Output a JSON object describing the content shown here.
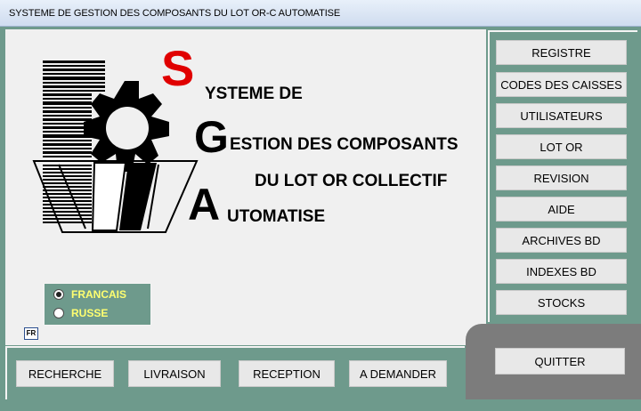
{
  "window": {
    "title": "SYSTEME DE GESTION DES COMPOSANTS DU LOT OR-C AUTOMATISE"
  },
  "logo": {
    "letter_s": "S",
    "line1": "YSTEME DE",
    "letter_g": "G",
    "line2": "ESTION DES COMPOSANTS",
    "line3": "DU LOT OR COLLECTIF",
    "letter_a": "A",
    "line4": "UTOMATISE",
    "accent_color": "#e00000"
  },
  "language": {
    "options": [
      {
        "label": "FRANCAIS",
        "selected": true
      },
      {
        "label": "RUSSE",
        "selected": false
      }
    ],
    "indicator": "FR"
  },
  "sidebar": {
    "buttons": [
      {
        "label": "REGISTRE"
      },
      {
        "label": "CODES DES CAISSES"
      },
      {
        "label": "UTILISATEURS"
      },
      {
        "label": "LOT OR"
      },
      {
        "label": "REVISION"
      },
      {
        "label": "AIDE"
      },
      {
        "label": "ARCHIVES BD"
      },
      {
        "label": "INDEXES BD"
      },
      {
        "label": "STOCKS"
      }
    ]
  },
  "bottom": {
    "buttons": [
      {
        "label": "RECHERCHE"
      },
      {
        "label": "LIVRAISON"
      },
      {
        "label": "RECEPTION"
      },
      {
        "label": "A DEMANDER"
      }
    ],
    "quit_label": "QUITTER"
  },
  "colors": {
    "panel": "#6e9a8c",
    "quit_panel": "#7c7c7c",
    "radio_text": "#ffff70"
  }
}
